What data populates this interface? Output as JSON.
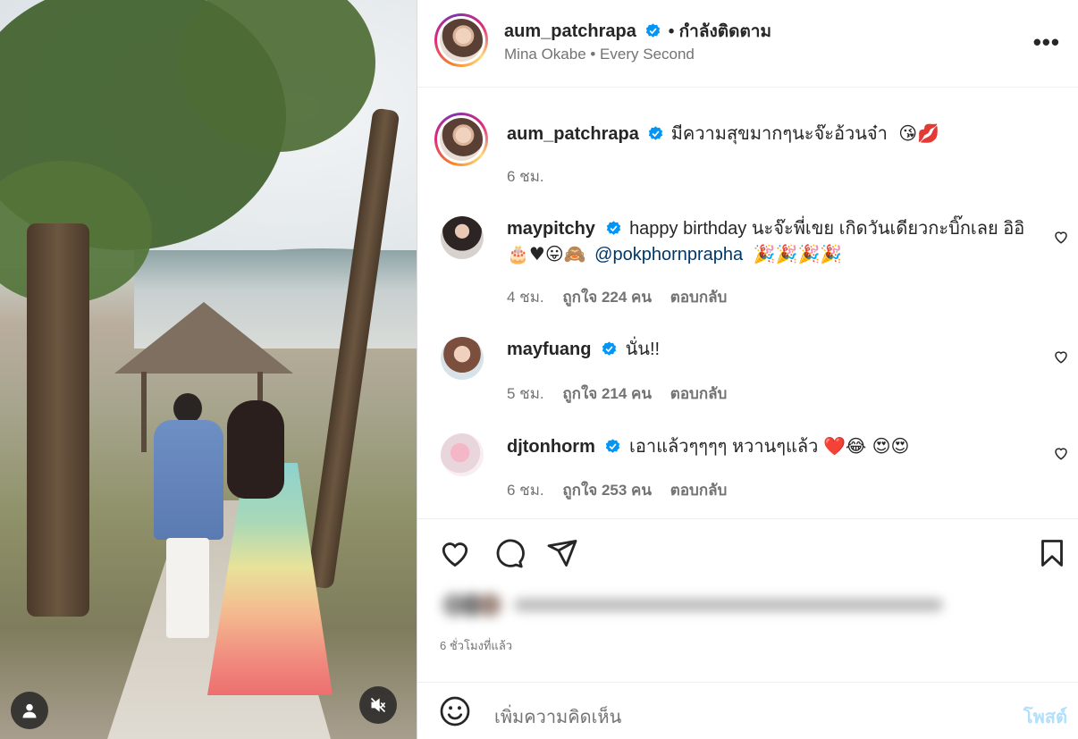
{
  "header": {
    "username": "aum_patchrapa",
    "follow_status": "• กำลังติดตาม",
    "audio": "Mina Okabe • Every Second"
  },
  "caption": {
    "username": "aum_patchrapa",
    "text": "มีความสุขมากๆนะจ๊ะอ้วนจ๋า",
    "emojis": "😘💋",
    "time": "6 ชม."
  },
  "comments": [
    {
      "username": "maypitchy",
      "text": "happy birthday นะจ๊ะพี่เขย เกิดวันเดียวกะบิ๊กเลย อิอิ",
      "line2_emojis": "🎂♥😛🙈",
      "mention": "@pokphornprapha",
      "trailing_emojis": "🎉🎉🎉🎉",
      "time": "4 ชม.",
      "likes": "ถูกใจ 224 คน",
      "reply": "ตอบกลับ"
    },
    {
      "username": "mayfuang",
      "text": "นั่น!!",
      "time": "5 ชม.",
      "likes": "ถูกใจ 214 คน",
      "reply": "ตอบกลับ"
    },
    {
      "username": "djtonhorm",
      "text": "เอาแล้วๆๆๆๆ หวานๆแล้ว",
      "emojis": "❤️😂 😍😍",
      "time": "6 ชม.",
      "likes": "ถูกใจ 253 คน",
      "reply": "ตอบกลับ"
    }
  ],
  "post_time": "6 ชั่วโมงที่แล้ว",
  "add_comment": {
    "placeholder": "เพิ่มความคิดเห็น",
    "post_label": "โพสต์"
  },
  "icons": {
    "verified": "verified-badge-icon",
    "like": "heart-icon",
    "comment": "comment-icon",
    "share": "send-icon",
    "save": "bookmark-icon",
    "emoji": "smiley-icon",
    "more": "more-options-icon",
    "mute": "speaker-muted-icon",
    "tags": "user-tag-icon"
  },
  "colors": {
    "verified": "#0095f6",
    "mention": "#00376b",
    "post_disabled": "#b2dffc"
  }
}
